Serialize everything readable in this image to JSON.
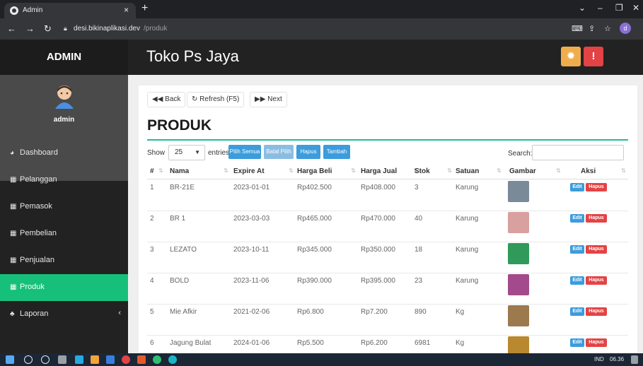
{
  "browser": {
    "tab_title": "Admin",
    "tab_close": "×",
    "new_tab": "+",
    "url_host": "desi.bikinaplikasi.dev",
    "url_path": "/produk",
    "profile_initial": "d",
    "window_controls": [
      "⌄",
      "–",
      "❐",
      "✕"
    ]
  },
  "sidebar": {
    "brand": "ADMIN",
    "username": "admin",
    "items": [
      {
        "label": "Dashboard",
        "icon": "dashboard-icon"
      },
      {
        "label": "Pelanggan",
        "icon": "table-icon"
      },
      {
        "label": "Pemasok",
        "icon": "table-icon"
      },
      {
        "label": "Pembelian",
        "icon": "table-icon"
      },
      {
        "label": "Penjualan",
        "icon": "table-icon"
      },
      {
        "label": "Produk",
        "icon": "table-icon",
        "active": true
      },
      {
        "label": "Laporan",
        "icon": "sitemap-icon",
        "caret": "‹"
      }
    ]
  },
  "topnav": {
    "title": "Toko Ps Jaya",
    "gear_icon": "gear-icon",
    "alert_icon": "exclamation-icon",
    "gear_color": "#f0ad4e",
    "alert_color": "#e34345"
  },
  "page": {
    "back_label": "Back",
    "refresh_label": "Refresh (F5)",
    "next_label": "Next",
    "heading": "PRODUK",
    "show_label": "Show",
    "entries_value": "25",
    "entries_label": "entries",
    "search_label": "Search:",
    "search_value": "",
    "buttons": {
      "select_all": "Pilih Semua",
      "cancel_select": "Batal Pilih",
      "delete": "Hapus",
      "add": "Tambah"
    }
  },
  "table": {
    "headers": [
      "#",
      "Nama",
      "Expire At",
      "Harga Beli",
      "Harga Jual",
      "Stok",
      "Satuan",
      "Gambar",
      "Aksi"
    ],
    "edit_label": "Edit",
    "delete_label": "Hapus",
    "rows": [
      {
        "no": "1",
        "nama": "BR-21E",
        "expire": "2023-01-01",
        "harga_beli": "Rp402.500",
        "harga_jual": "Rp408.000",
        "stok": "3",
        "satuan": "Karung",
        "thumb_color": "#7a8a99"
      },
      {
        "no": "2",
        "nama": "BR 1",
        "expire": "2023-03-03",
        "harga_beli": "Rp465.000",
        "harga_jual": "Rp470.000",
        "stok": "40",
        "satuan": "Karung",
        "thumb_color": "#d9a0a0"
      },
      {
        "no": "3",
        "nama": "LEZATO",
        "expire": "2023-10-11",
        "harga_beli": "Rp345.000",
        "harga_jual": "Rp350.000",
        "stok": "18",
        "satuan": "Karung",
        "thumb_color": "#2f9a5a"
      },
      {
        "no": "4",
        "nama": "BOLD",
        "expire": "2023-11-06",
        "harga_beli": "Rp390.000",
        "harga_jual": "Rp395.000",
        "stok": "23",
        "satuan": "Karung",
        "thumb_color": "#a24a8c"
      },
      {
        "no": "5",
        "nama": "Mie Afkir",
        "expire": "2021-02-06",
        "harga_beli": "Rp6.800",
        "harga_jual": "Rp7.200",
        "stok": "890",
        "satuan": "Kg",
        "thumb_color": "#9c7a4e"
      },
      {
        "no": "6",
        "nama": "Jagung Bulat",
        "expire": "2024-01-06",
        "harga_beli": "Rp5.500",
        "harga_jual": "Rp6.200",
        "stok": "6981",
        "satuan": "Kg",
        "thumb_color": "#b8892f"
      }
    ]
  },
  "taskbar": {
    "tray_text": "IND",
    "time": "06.36"
  }
}
